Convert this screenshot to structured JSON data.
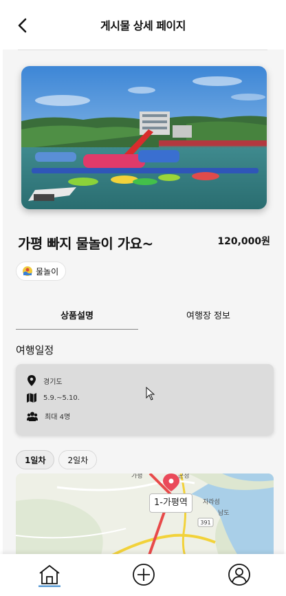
{
  "header": {
    "title": "게시물 상세 페이지"
  },
  "post": {
    "title": "가평 빠지 물놀이 가요~",
    "price": "120,000원",
    "category": "물놀이"
  },
  "tabs": [
    {
      "label": "상품설명",
      "active": true
    },
    {
      "label": "여행장 정보",
      "active": false
    }
  ],
  "schedule": {
    "section_title": "여행일정",
    "location": "경기도",
    "dates": "5.9.~5.10.",
    "capacity": "최대 4명"
  },
  "days": [
    {
      "label": "1일차",
      "active": true
    },
    {
      "label": "2일차",
      "active": false
    }
  ],
  "map": {
    "marker_label": "1-가평역",
    "road_badge": "391",
    "place_labels": [
      "가평",
      "군청",
      "자라섬",
      "남도"
    ]
  },
  "icons": {
    "back": "chevron-left-icon",
    "location": "location-pin-icon",
    "dates": "map-icon",
    "capacity": "people-icon",
    "category": "water-play-icon",
    "nav_home": "home-icon",
    "nav_add": "plus-circle-icon",
    "nav_profile": "user-icon"
  },
  "colors": {
    "background": "#f5f5f5",
    "card": "#dcdcdc",
    "map_marker": "#ea4a5a",
    "active_nav": "#5a9bd5"
  }
}
